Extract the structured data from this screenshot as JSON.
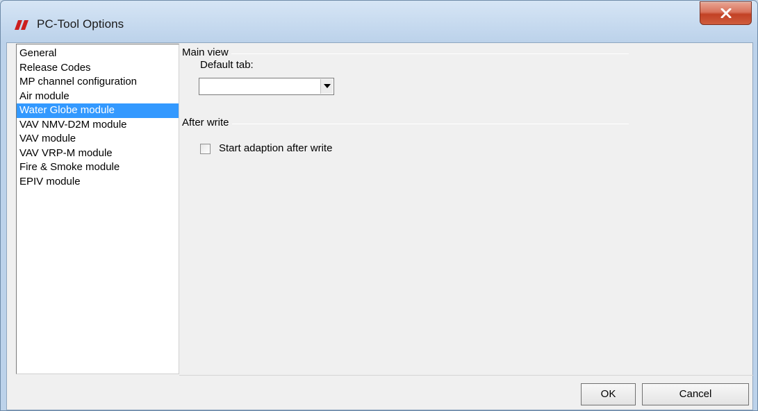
{
  "window": {
    "title": "PC-Tool Options",
    "close_icon": "close-icon"
  },
  "categories": {
    "items": [
      {
        "label": "General"
      },
      {
        "label": "Release Codes"
      },
      {
        "label": "MP channel configuration"
      },
      {
        "label": "Air module"
      },
      {
        "label": "Water Globe module",
        "selected": true
      },
      {
        "label": "VAV NMV-D2M module"
      },
      {
        "label": "VAV module"
      },
      {
        "label": "VAV VRP-M module"
      },
      {
        "label": "Fire & Smoke module"
      },
      {
        "label": "EPIV module"
      }
    ],
    "selected_color": "#3399ff"
  },
  "main_view": {
    "group_label": "Main view",
    "default_tab_label": "Default tab:",
    "default_tab_value": ""
  },
  "after_write": {
    "group_label": "After write",
    "start_adaption_label": "Start adaption after write",
    "start_adaption_checked": false
  },
  "buttons": {
    "ok": "OK",
    "cancel": "Cancel"
  },
  "colors": {
    "close_button": "#c24125",
    "logo": "#cc1f1f"
  }
}
